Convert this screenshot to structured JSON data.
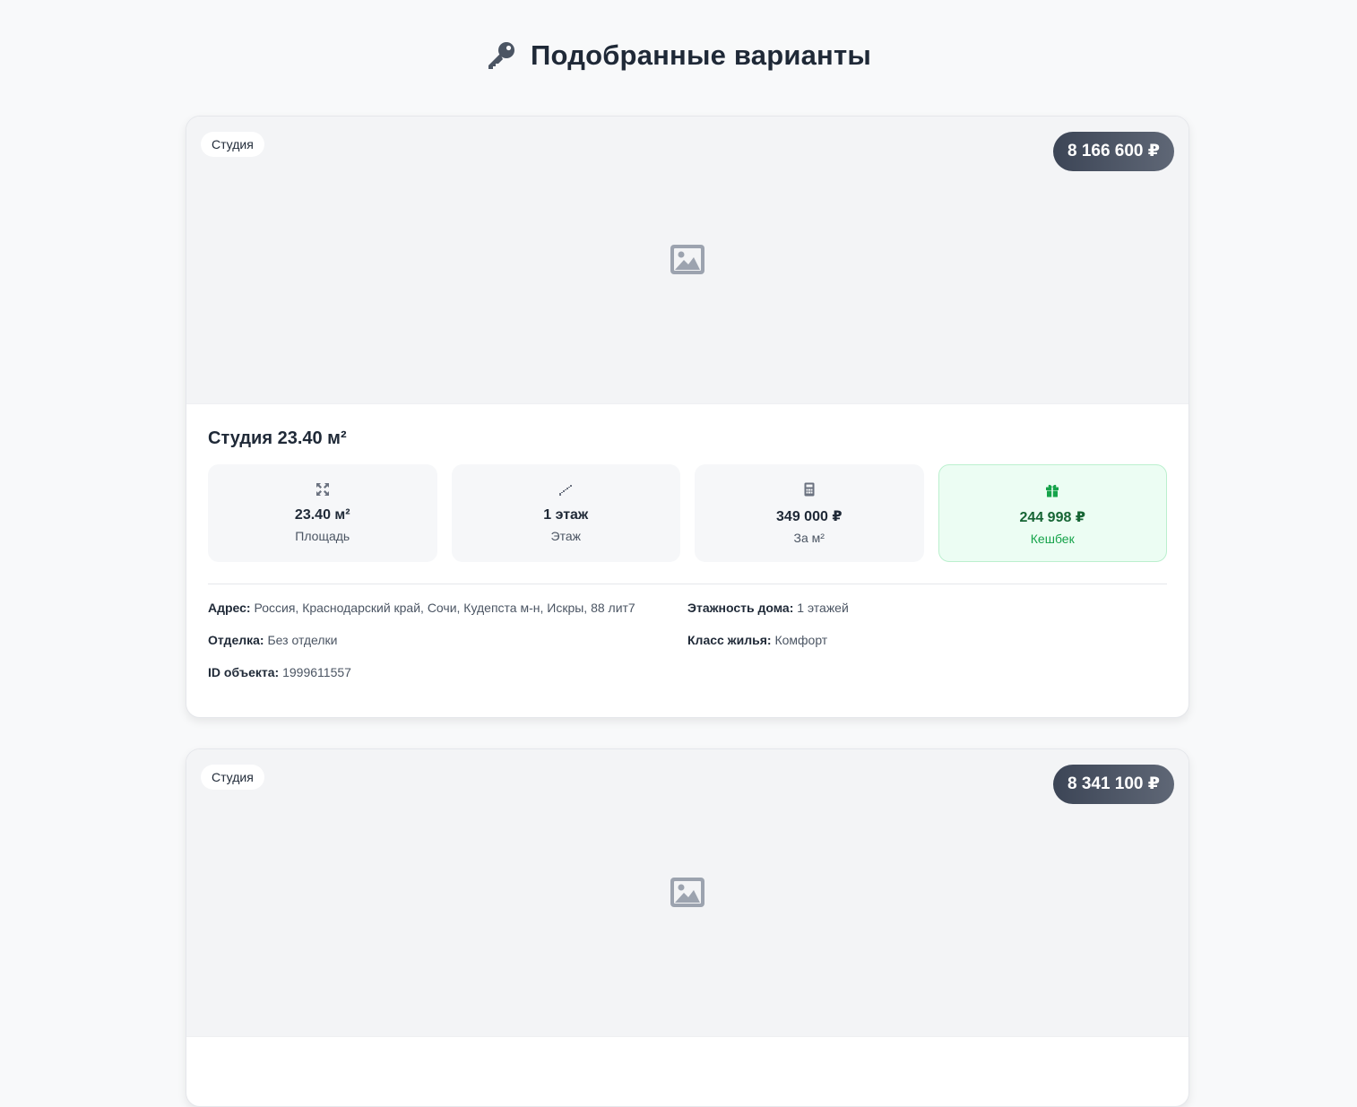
{
  "header": {
    "title": "Подобранные варианты",
    "icon": "key-icon"
  },
  "cards": [
    {
      "type_badge": "Студия",
      "price": "8 166 600 ₽",
      "image": "image-placeholder-icon",
      "title": "Студия 23.40 м²",
      "stats": [
        {
          "icon": "expand-icon",
          "value": "23.40 м²",
          "label": "Площадь"
        },
        {
          "icon": "stairs-icon",
          "value": "1 этаж",
          "label": "Этаж"
        },
        {
          "icon": "calculator-icon",
          "value": "349 000 ₽",
          "label": "За м²"
        },
        {
          "icon": "gift-icon",
          "value": "244 998 ₽",
          "label": "Кешбек"
        }
      ],
      "details": {
        "address_label": "Адрес:",
        "address_value": "Россия, Краснодарский край, Сочи, Кудепста м-н, Искры, 88 лит7",
        "finish_label": "Отделка:",
        "finish_value": "Без отделки",
        "id_label": "ID объекта:",
        "id_value": "1999611557",
        "floors_label": "Этажность дома:",
        "floors_value": "1 этажей",
        "class_label": "Класс жилья:",
        "class_value": "Комфорт"
      }
    },
    {
      "type_badge": "Студия",
      "price": "8 341 100 ₽",
      "image": "image-placeholder-icon"
    }
  ],
  "colors": {
    "background": "#f8f9fa",
    "price_badge": "#3c4556",
    "cashback_bg": "#ecfdf3",
    "cashback_text": "#166534"
  }
}
